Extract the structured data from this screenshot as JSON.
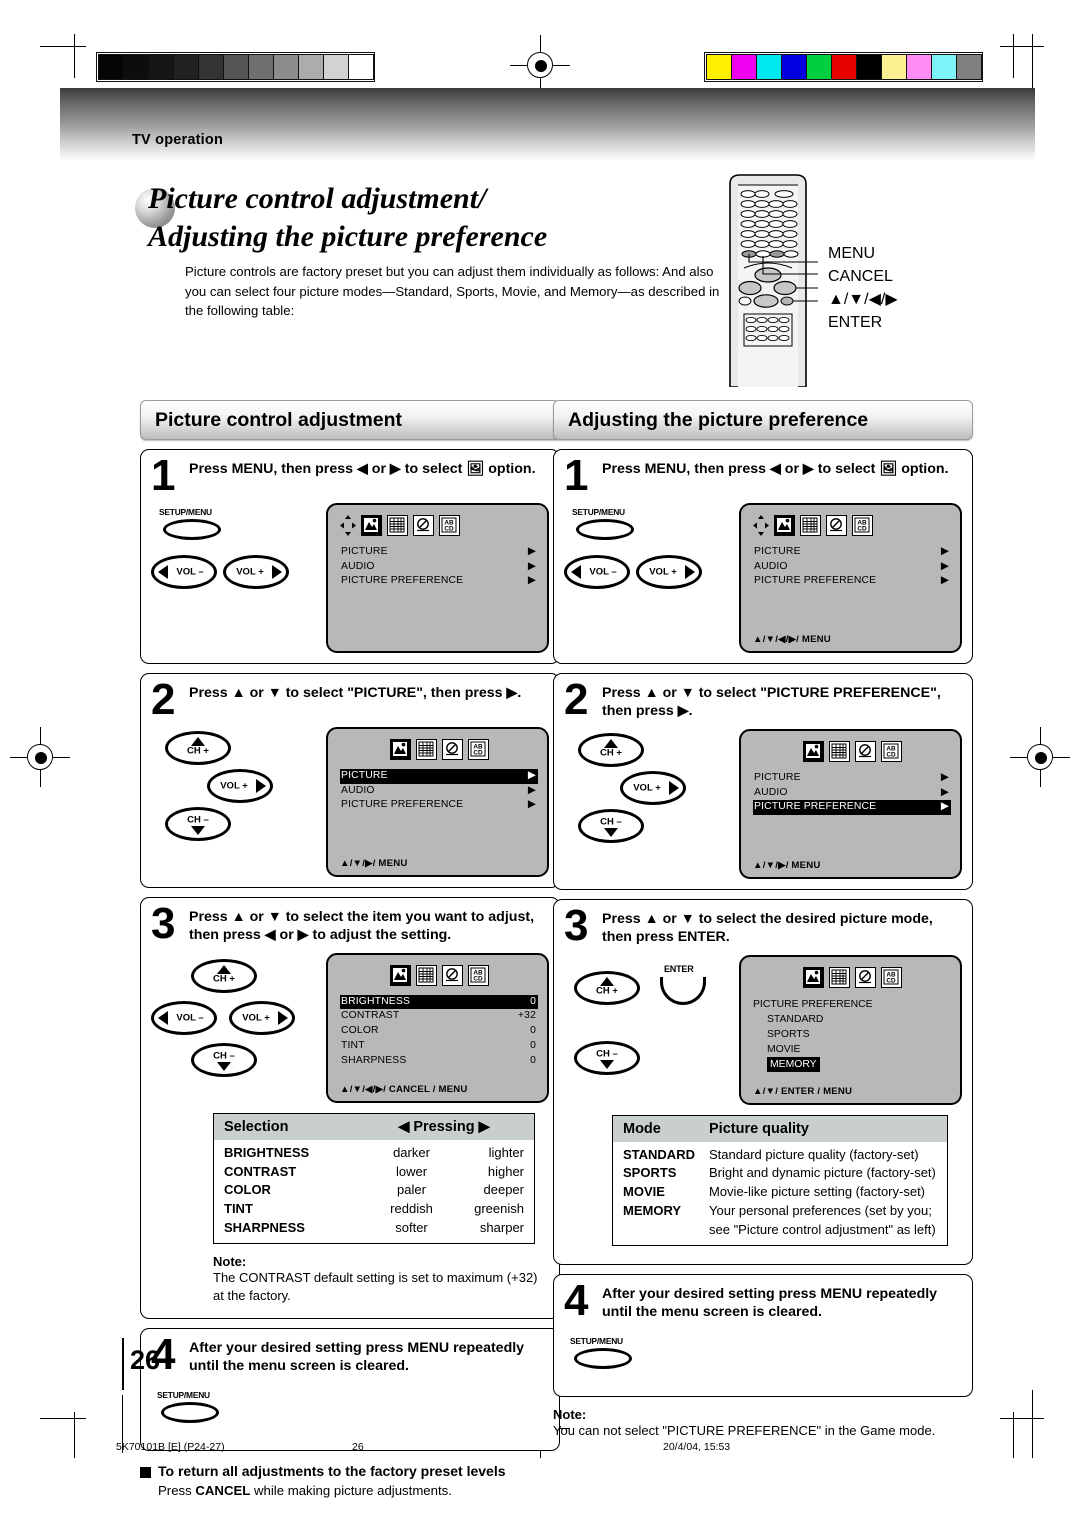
{
  "page": {
    "header_label": "TV operation",
    "page_number": "26",
    "footer_code": "5K70101B [E] (P24-27)",
    "footer_page": "26",
    "footer_date": "20/4/04, 15:53"
  },
  "title": {
    "line1": "Picture control adjustment/",
    "line2": "Adjusting the picture preference",
    "intro": "Picture controls are factory preset but you can adjust them individually as follows: And also you can select four picture modes—Standard, Sports, Movie, and Memory—as described in the following table:"
  },
  "remote": {
    "labels": [
      "MENU",
      "CANCEL",
      "▲/▼/◀/▶",
      "ENTER"
    ]
  },
  "left_column": {
    "heading": "Picture control adjustment",
    "steps": [
      {
        "num": "1",
        "text": "Press MENU, then press ◀ or ▶ to select 🖼 option.",
        "keys": [
          {
            "label": "SETUP/MENU",
            "type": "oval"
          },
          {
            "label": "VOL –",
            "type": "arrow-left"
          },
          {
            "label": "VOL +",
            "type": "arrow-right"
          }
        ],
        "osd": {
          "cursor": true,
          "icons": [
            "picture-icon",
            "channel-icon",
            "lock-icon",
            "caption-icon"
          ],
          "selected_icon": 0,
          "lines": [
            {
              "label": "PICTURE",
              "value": "▶",
              "highlight": false
            },
            {
              "label": "AUDIO",
              "value": "▶",
              "highlight": false
            },
            {
              "label": "PICTURE  PREFERENCE",
              "value": "▶",
              "highlight": false
            }
          ],
          "footer": ""
        }
      },
      {
        "num": "2",
        "text": "Press ▲ or ▼ to select \"PICTURE\", then press ▶.",
        "keys": [
          {
            "label": "CH +",
            "type": "arrow-up"
          },
          {
            "label": "VOL +",
            "type": "arrow-right"
          },
          {
            "label": "CH –",
            "type": "arrow-down"
          }
        ],
        "osd": {
          "cursor": false,
          "icons": [
            "picture-icon",
            "channel-icon",
            "lock-icon",
            "caption-icon"
          ],
          "selected_icon": 0,
          "lines": [
            {
              "label": "PICTURE",
              "value": "▶",
              "highlight": true
            },
            {
              "label": "AUDIO",
              "value": "▶",
              "highlight": false
            },
            {
              "label": "PICTURE  PREFERENCE",
              "value": "▶",
              "highlight": false
            }
          ],
          "footer": "▲/▼/▶/ MENU"
        }
      },
      {
        "num": "3",
        "text": "Press ▲ or ▼ to select the item you want to adjust, then press ◀ or ▶ to adjust the setting.",
        "keys": [
          {
            "label": "CH +",
            "type": "arrow-up"
          },
          {
            "label": "VOL –",
            "type": "arrow-left"
          },
          {
            "label": "VOL +",
            "type": "arrow-right"
          },
          {
            "label": "CH –",
            "type": "arrow-down"
          }
        ],
        "osd": {
          "cursor": false,
          "icons": [
            "picture-icon",
            "channel-icon",
            "lock-icon",
            "caption-icon"
          ],
          "selected_icon": 0,
          "lines": [
            {
              "label": "BRIGHTNESS",
              "value": "0",
              "highlight": true
            },
            {
              "label": "CONTRAST",
              "value": "+32",
              "highlight": false
            },
            {
              "label": "COLOR",
              "value": "0",
              "highlight": false
            },
            {
              "label": "TINT",
              "value": "0",
              "highlight": false
            },
            {
              "label": "SHARPNESS",
              "value": "0",
              "highlight": false
            }
          ],
          "footer": "▲/▼/◀/▶/ CANCEL / MENU"
        }
      },
      {
        "num": "4",
        "text": "After your desired setting press MENU repeatedly until the menu screen is cleared.",
        "keys": [
          {
            "label": "SETUP/MENU",
            "type": "oval"
          }
        ]
      }
    ],
    "table": {
      "header": {
        "selection": "Selection",
        "pressing": "◀  Pressing  ▶"
      },
      "rows": [
        {
          "selection": "BRIGHTNESS",
          "left": "darker",
          "right": "lighter"
        },
        {
          "selection": "CONTRAST",
          "left": "lower",
          "right": "higher"
        },
        {
          "selection": "COLOR",
          "left": "paler",
          "right": "deeper"
        },
        {
          "selection": "TINT",
          "left": "reddish",
          "right": "greenish"
        },
        {
          "selection": "SHARPNESS",
          "left": "softer",
          "right": "sharper"
        }
      ]
    },
    "note": {
      "title": "Note:",
      "body": "The CONTRAST default setting is set to maximum (+32) at the factory."
    },
    "reset": {
      "heading": "To return all adjustments to the factory preset levels",
      "body": "Press CANCEL while making picture adjustments.",
      "body_pre": "Press ",
      "body_bold": "CANCEL",
      "body_post": " while making picture adjustments."
    }
  },
  "right_column": {
    "heading": "Adjusting the picture preference",
    "steps": [
      {
        "num": "1",
        "text": "Press MENU, then press ◀ or ▶ to select 🖼 option.",
        "keys": [
          {
            "label": "SETUP/MENU",
            "type": "oval"
          },
          {
            "label": "VOL –",
            "type": "arrow-left"
          },
          {
            "label": "VOL +",
            "type": "arrow-right"
          }
        ],
        "osd": {
          "cursor": true,
          "icons": [
            "picture-icon",
            "channel-icon",
            "lock-icon",
            "caption-icon"
          ],
          "selected_icon": 0,
          "lines": [
            {
              "label": "PICTURE",
              "value": "▶",
              "highlight": false
            },
            {
              "label": "AUDIO",
              "value": "▶",
              "highlight": false
            },
            {
              "label": "PICTURE  PREFERENCE",
              "value": "▶",
              "highlight": false
            }
          ],
          "footer": "▲/▼/◀/▶/ MENU"
        }
      },
      {
        "num": "2",
        "text": "Press ▲ or ▼ to select \"PICTURE PREFERENCE\", then press ▶.",
        "keys": [
          {
            "label": "CH +",
            "type": "arrow-up"
          },
          {
            "label": "VOL +",
            "type": "arrow-right"
          },
          {
            "label": "CH –",
            "type": "arrow-down"
          }
        ],
        "osd": {
          "cursor": false,
          "icons": [
            "picture-icon",
            "channel-icon",
            "lock-icon",
            "caption-icon"
          ],
          "selected_icon": 0,
          "lines": [
            {
              "label": "PICTURE",
              "value": "▶",
              "highlight": false
            },
            {
              "label": "AUDIO",
              "value": "▶",
              "highlight": false
            },
            {
              "label": "PICTURE  PREFERENCE",
              "value": "▶",
              "highlight": true
            }
          ],
          "footer": "▲/▼/▶/ MENU"
        }
      },
      {
        "num": "3",
        "text": "Press ▲ or ▼ to select the desired picture mode, then press ENTER.",
        "keys": [
          {
            "label": "CH +",
            "type": "arrow-up"
          },
          {
            "label": "ENTER",
            "type": "enter"
          },
          {
            "label": "CH –",
            "type": "arrow-down"
          }
        ],
        "osd_pref": {
          "icons": [
            "picture-icon",
            "channel-icon",
            "lock-icon",
            "caption-icon"
          ],
          "title": "PICTURE PREFERENCE",
          "items": [
            {
              "label": "STANDARD",
              "highlight": false
            },
            {
              "label": "SPORTS",
              "highlight": false
            },
            {
              "label": "MOVIE",
              "highlight": false
            },
            {
              "label": "MEMORY",
              "highlight": true
            }
          ],
          "footer": "▲/▼/ ENTER / MENU"
        }
      },
      {
        "num": "4",
        "text": "After your desired setting press MENU repeatedly until the menu screen is cleared.",
        "keys": [
          {
            "label": "SETUP/MENU",
            "type": "oval"
          }
        ]
      }
    ],
    "table": {
      "header": {
        "mode": "Mode",
        "quality": "Picture quality"
      },
      "rows": [
        {
          "mode": "STANDARD",
          "quality": "Standard picture quality (factory-set)"
        },
        {
          "mode": "SPORTS",
          "quality": "Bright and dynamic picture (factory-set)"
        },
        {
          "mode": "MOVIE",
          "quality": "Movie-like picture setting (factory-set)"
        },
        {
          "mode": "MEMORY",
          "quality": "Your personal preferences (set by you;"
        },
        {
          "mode": "",
          "quality": "see \"Picture control adjustment\" as left)"
        }
      ]
    },
    "note": {
      "title": "Note:",
      "body": "You can not select \"PICTURE PREFERENCE\" in the Game mode."
    }
  },
  "colors": {
    "gray_bars": [
      "#050505",
      "#0d0d0d",
      "#161616",
      "#222222",
      "#333333",
      "#555555",
      "#707070",
      "#8d8d8d",
      "#acacac",
      "#d2d2d2",
      "#ffffff"
    ],
    "color_bars": [
      "#fff000",
      "#ef00ef",
      "#00e9ef",
      "#0000e0",
      "#00d040",
      "#e80000",
      "#000000",
      "#fbf193",
      "#ff8df5",
      "#7ef3f7",
      "#808080"
    ]
  }
}
